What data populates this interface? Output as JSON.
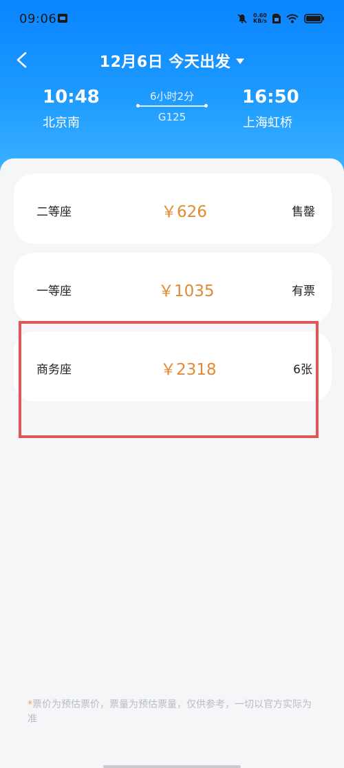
{
  "status_bar": {
    "time": "09:06",
    "net_speed_value": "0.60",
    "net_speed_unit": "KB/s"
  },
  "nav": {
    "date": "12月6日",
    "depart_label": "今天出发"
  },
  "trip": {
    "depart_time": "10:48",
    "depart_station": "北京南",
    "duration": "6小时2分",
    "train_no": "G125",
    "arrive_time": "16:50",
    "arrive_station": "上海虹桥"
  },
  "seats": [
    {
      "name": "二等座",
      "price": "￥626",
      "status": "售罄"
    },
    {
      "name": "一等座",
      "price": "￥1035",
      "status": "有票"
    },
    {
      "name": "商务座",
      "price": "￥2318",
      "status": "6张"
    }
  ],
  "disclaimer": {
    "star": "*",
    "text": "票价为预估票价，票量为预估票量，仅供参考，一切以官方实际为准"
  },
  "colors": {
    "header_blue": "#0a84ff",
    "price_orange": "#e08a33",
    "highlight_red": "#e25555"
  }
}
